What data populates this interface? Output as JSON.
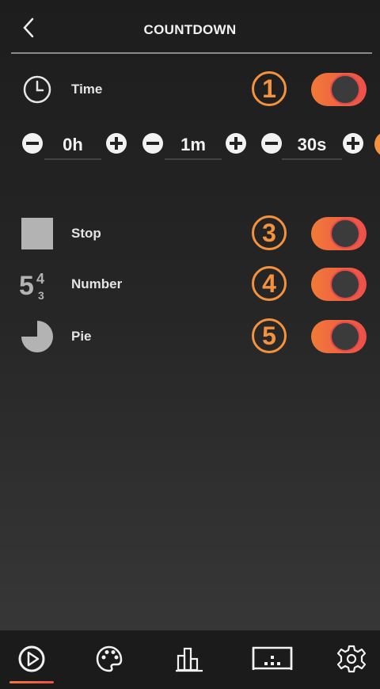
{
  "header": {
    "title": "COUNTDOWN"
  },
  "time": {
    "label": "Time",
    "badge": "1",
    "enabled": true,
    "hours": "0h",
    "minutes": "1m",
    "seconds": "30s"
  },
  "stop": {
    "label": "Stop",
    "badge": "3",
    "enabled": true
  },
  "number": {
    "label": "Number",
    "badge": "4",
    "enabled": true,
    "icon_big": "5",
    "icon_top": "4",
    "icon_bottom": "3"
  },
  "pie": {
    "label": "Pie",
    "badge": "5",
    "enabled": true
  },
  "tabs": [
    "play-icon",
    "palette-icon",
    "chart-icon",
    "scoreboard-icon",
    "gear-icon"
  ],
  "colors": {
    "accent": "#f5923e",
    "toggle_end": "#ee4f4a"
  }
}
